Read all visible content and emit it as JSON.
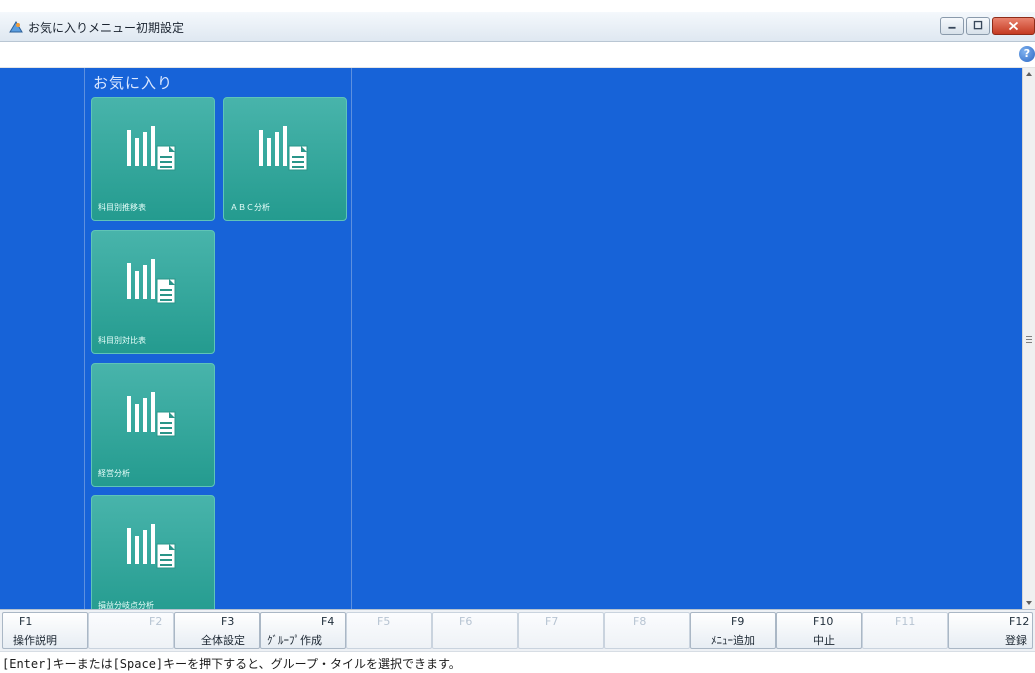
{
  "window": {
    "title": "お気に入りメニュー初期設定"
  },
  "group": {
    "title": "お気に入り"
  },
  "tiles": [
    {
      "label": "科目別推移表"
    },
    {
      "label": "ＡＢＣ分析"
    },
    {
      "label": "科目別対比表"
    },
    {
      "label": "経営分析"
    },
    {
      "label": "損益分岐点分析"
    }
  ],
  "function_keys": [
    {
      "num": "F1",
      "label": "操作説明",
      "enabled": true
    },
    {
      "num": "F2",
      "label": "",
      "enabled": false
    },
    {
      "num": "F3",
      "label": "全体設定",
      "enabled": true
    },
    {
      "num": "F4",
      "label": "ｸﾞﾙｰﾌﾟ作成",
      "enabled": true
    },
    {
      "num": "F5",
      "label": "",
      "enabled": false
    },
    {
      "num": "F6",
      "label": "",
      "enabled": false
    },
    {
      "num": "F7",
      "label": "",
      "enabled": false
    },
    {
      "num": "F8",
      "label": "",
      "enabled": false
    },
    {
      "num": "F9",
      "label": "ﾒﾆｭｰ追加",
      "enabled": true
    },
    {
      "num": "F10",
      "label": "中止",
      "enabled": true
    },
    {
      "num": "F11",
      "label": "",
      "enabled": false
    },
    {
      "num": "F12",
      "label": "登録",
      "enabled": true
    }
  ],
  "status": {
    "message": "[Enter]キーまたは[Space]キーを押下すると、グループ・タイルを選択できます。"
  },
  "colors": {
    "content_background": "#1763d8",
    "tile": "#2fa398"
  },
  "icons": {
    "tile": "report-chart-icon",
    "help": "help-icon"
  }
}
